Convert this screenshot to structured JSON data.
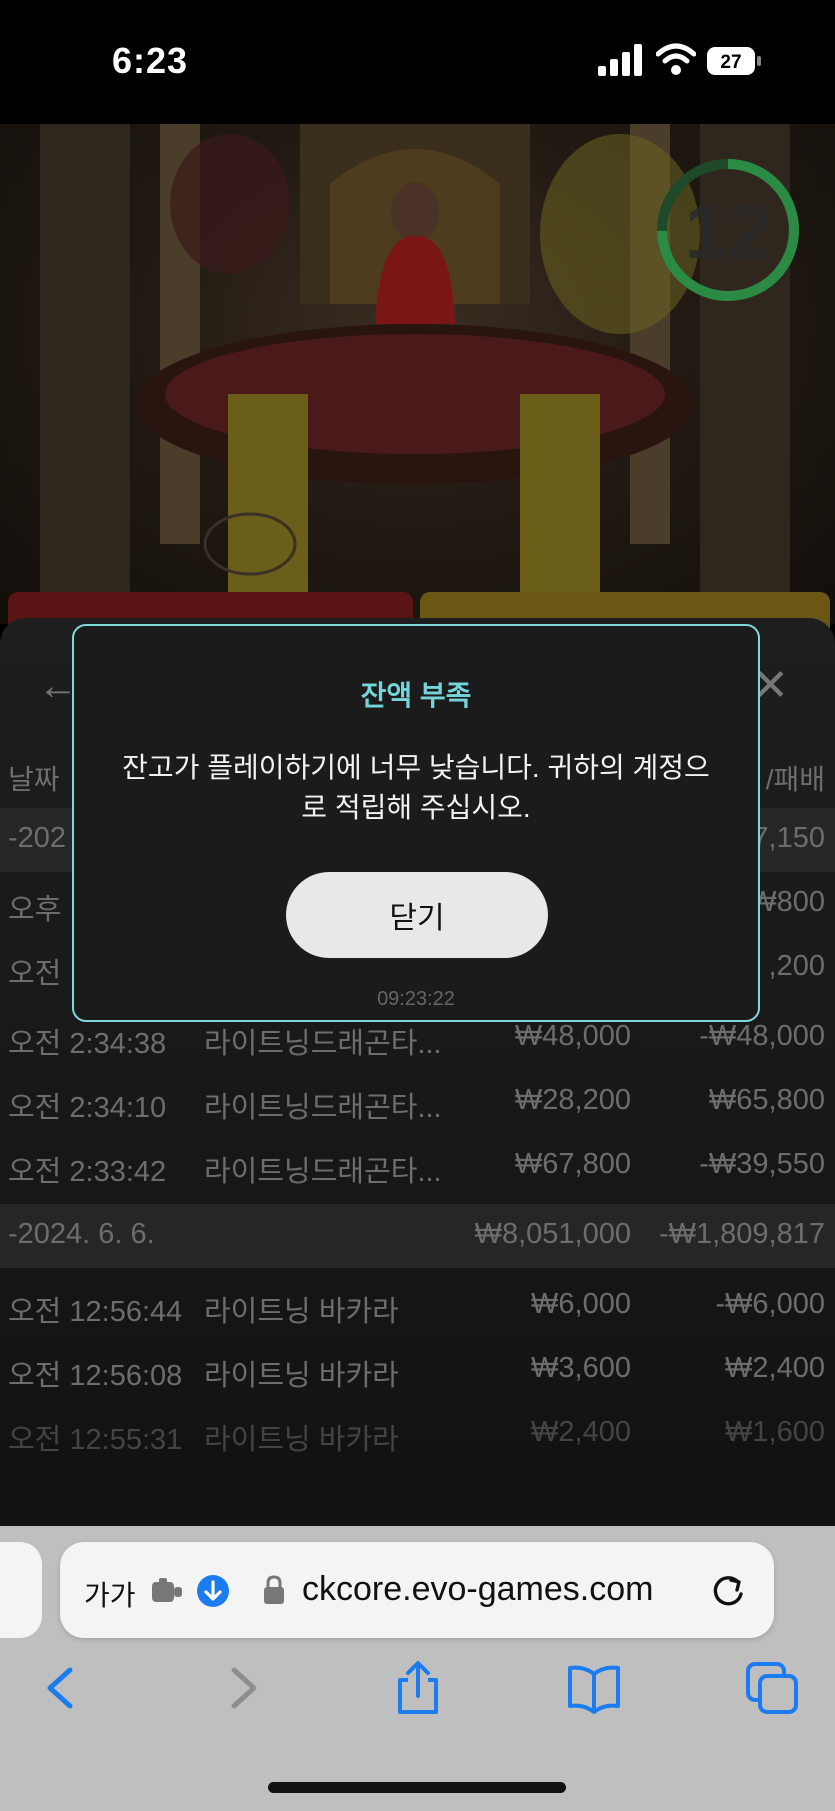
{
  "status_bar": {
    "time": "6:23",
    "battery": "27"
  },
  "game": {
    "countdown": "12"
  },
  "modal": {
    "title": "잔액 부족",
    "message": "잔고가 플레이하기에 너무 낮습니다. 귀하의 계정으로 적립해 주십시오.",
    "button": "닫기",
    "timestamp": "09:23:22"
  },
  "history": {
    "header": {
      "date": "날짜",
      "result": "/패배"
    },
    "rows": [
      {
        "type": "group",
        "date": "-202",
        "bet": "",
        "result": "₩7,150"
      },
      {
        "type": "item",
        "time": "오후",
        "game": "",
        "bet": "",
        "result": "₩800"
      },
      {
        "type": "item",
        "time": "오전",
        "game": "",
        "bet": "",
        "result": ",200"
      },
      {
        "type": "item",
        "time": "오전 2:34:38",
        "game": "라이트닝드래곤타...",
        "bet": "₩48,000",
        "result": "-₩48,000"
      },
      {
        "type": "item",
        "time": "오전 2:34:10",
        "game": "라이트닝드래곤타...",
        "bet": "₩28,200",
        "result": "₩65,800"
      },
      {
        "type": "item",
        "time": "오전 2:33:42",
        "game": "라이트닝드래곤타...",
        "bet": "₩67,800",
        "result": "-₩39,550"
      },
      {
        "type": "group",
        "date": "-2024. 6. 6.",
        "bet": "₩8,051,000",
        "result": "-₩1,809,817"
      },
      {
        "type": "item",
        "time": "오전 12:56:44",
        "game": "라이트닝 바카라",
        "bet": "₩6,000",
        "result": "-₩6,000"
      },
      {
        "type": "item",
        "time": "오전 12:56:08",
        "game": "라이트닝 바카라",
        "bet": "₩3,600",
        "result": "₩2,400"
      },
      {
        "type": "item",
        "time": "오전 12:55:31",
        "game": "라이트닝 바카라",
        "bet": "₩2,400",
        "result": "₩1,600"
      }
    ]
  },
  "browser": {
    "aa_label": "가가",
    "url": "ckcore.evo-games.com"
  },
  "icons": [
    "signal-icon",
    "wifi-icon",
    "battery-icon",
    "back-arrow-icon",
    "close-icon",
    "extension-icon",
    "download-icon",
    "lock-icon",
    "reload-icon",
    "back-icon",
    "forward-icon",
    "share-icon",
    "bookmarks-icon",
    "tabs-icon"
  ],
  "colors": {
    "accent": "#74d4d9",
    "safari_blue": "#1a7cf0"
  }
}
